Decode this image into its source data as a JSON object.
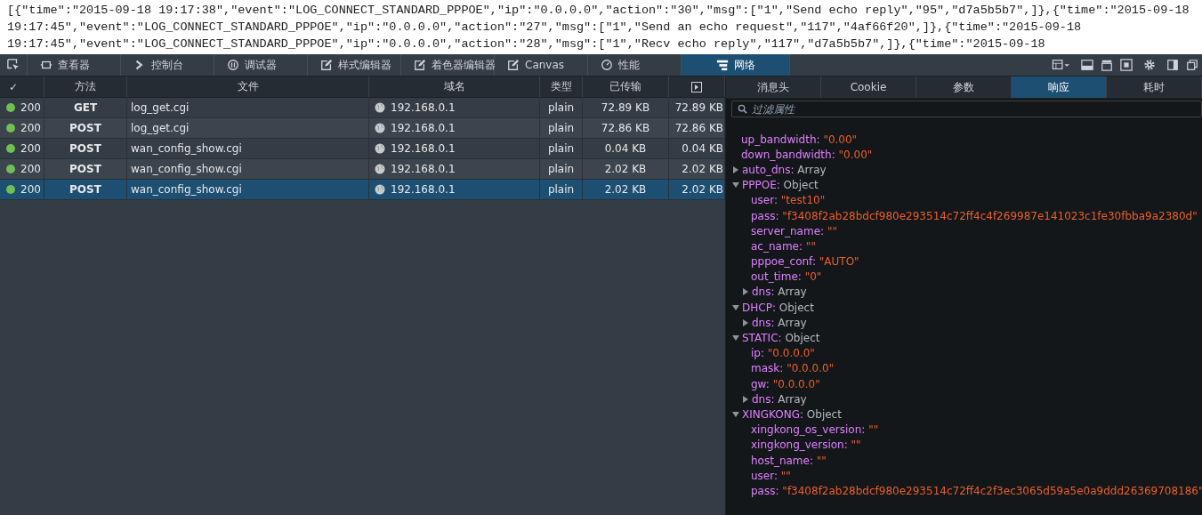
{
  "page_text": [
    "[{\"time\":\"2015-09-18 19:17:38\",\"event\":\"LOG_CONNECT_STANDARD_PPPOE\",\"ip\":\"0.0.0.0\",\"action\":\"30\",\"msg\":[\"1\",\"Send echo reply\",\"95\",\"d7a5b5b7\",]},{\"time\":\"2015-09-18",
    "19:17:45\",\"event\":\"LOG_CONNECT_STANDARD_PPPOE\",\"ip\":\"0.0.0.0\",\"action\":\"27\",\"msg\":[\"1\",\"Send an echo request\",\"117\",\"4af66f20\",]},{\"time\":\"2015-09-18",
    "19:17:45\",\"event\":\"LOG_CONNECT_STANDARD_PPPOE\",\"ip\":\"0.0.0.0\",\"action\":\"28\",\"msg\":[\"1\",\"Recv echo reply\",\"117\",\"d7a5b5b7\",]},{\"time\":\"2015-09-18"
  ],
  "toolbar": {
    "tabs": [
      {
        "label": "查看器",
        "selected": false
      },
      {
        "label": "控制台",
        "selected": false
      },
      {
        "label": "调试器",
        "selected": false
      },
      {
        "label": "样式编辑器",
        "selected": false
      },
      {
        "label": "着色器编辑器",
        "selected": false
      },
      {
        "label": "Canvas",
        "selected": false
      },
      {
        "label": "性能",
        "selected": false
      },
      {
        "label": "网络",
        "selected": true
      }
    ]
  },
  "table": {
    "columns": [
      "✓",
      "方法",
      "文件",
      "域名",
      "类型",
      "已传输"
    ],
    "rows": [
      {
        "status": "200",
        "method": "GET",
        "file": "log_get.cgi",
        "domain": "192.168.0.1",
        "type": "plain",
        "transferred": "72.89 KB",
        "size": "72.89 KB",
        "selected": false
      },
      {
        "status": "200",
        "method": "POST",
        "file": "log_get.cgi",
        "domain": "192.168.0.1",
        "type": "plain",
        "transferred": "72.86 KB",
        "size": "72.86 KB",
        "selected": false
      },
      {
        "status": "200",
        "method": "POST",
        "file": "wan_config_show.cgi",
        "domain": "192.168.0.1",
        "type": "plain",
        "transferred": "0.04 KB",
        "size": "0.04 KB",
        "selected": false
      },
      {
        "status": "200",
        "method": "POST",
        "file": "wan_config_show.cgi",
        "domain": "192.168.0.1",
        "type": "plain",
        "transferred": "2.02 KB",
        "size": "2.02 KB",
        "selected": false
      },
      {
        "status": "200",
        "method": "POST",
        "file": "wan_config_show.cgi",
        "domain": "192.168.0.1",
        "type": "plain",
        "transferred": "2.02 KB",
        "size": "2.02 KB",
        "selected": true
      }
    ]
  },
  "details": {
    "tabs": [
      {
        "label": "消息头",
        "selected": false
      },
      {
        "label": "Cookie",
        "selected": false
      },
      {
        "label": "参数",
        "selected": false
      },
      {
        "label": "响应",
        "selected": true
      },
      {
        "label": "耗时",
        "selected": false
      }
    ],
    "filter": {
      "placeholder": "过滤属性"
    },
    "tree": [
      {
        "key": "up_bandwidth:",
        "value": "\"0.00\"",
        "kind": "string"
      },
      {
        "key": "down_bandwidth:",
        "value": "\"0.00\"",
        "kind": "string"
      },
      {
        "key": "auto_dns:",
        "value": "Array",
        "kind": "type",
        "expanded": false
      },
      {
        "key": "PPPOE:",
        "value": "Object",
        "kind": "type",
        "expanded": true,
        "children": [
          {
            "key": "user:",
            "value": "\"test10\"",
            "kind": "string"
          },
          {
            "key": "pass:",
            "value": "\"f3408f2ab28bdcf980e293514c72ff4c4f269987e141023c1fe30fbba9a2380d\"",
            "kind": "string"
          },
          {
            "key": "server_name:",
            "value": "\"\"",
            "kind": "string"
          },
          {
            "key": "ac_name:",
            "value": "\"\"",
            "kind": "string"
          },
          {
            "key": "pppoe_conf:",
            "value": "\"AUTO\"",
            "kind": "string"
          },
          {
            "key": "out_time:",
            "value": "\"0\"",
            "kind": "string"
          },
          {
            "key": "dns:",
            "value": "Array",
            "kind": "type",
            "expanded": false
          }
        ]
      },
      {
        "key": "DHCP:",
        "value": "Object",
        "kind": "type",
        "expanded": true,
        "children": [
          {
            "key": "dns:",
            "value": "Array",
            "kind": "type",
            "expanded": false
          }
        ]
      },
      {
        "key": "STATIC:",
        "value": "Object",
        "kind": "type",
        "expanded": true,
        "children": [
          {
            "key": "ip:",
            "value": "\"0.0.0.0\"",
            "kind": "string"
          },
          {
            "key": "mask:",
            "value": "\"0.0.0.0\"",
            "kind": "string"
          },
          {
            "key": "gw:",
            "value": "\"0.0.0.0\"",
            "kind": "string"
          },
          {
            "key": "dns:",
            "value": "Array",
            "kind": "type",
            "expanded": false
          }
        ]
      },
      {
        "key": "XINGKONG:",
        "value": "Object",
        "kind": "type",
        "expanded": true,
        "children": [
          {
            "key": "xingkong_os_version:",
            "value": "\"\"",
            "kind": "string"
          },
          {
            "key": "xingkong_version:",
            "value": "\"\"",
            "kind": "string"
          },
          {
            "key": "host_name:",
            "value": "\"\"",
            "kind": "string"
          },
          {
            "key": "user:",
            "value": "\"\"",
            "kind": "string"
          },
          {
            "key": "pass:",
            "value": "\"f3408f2ab28bdcf980e293514c72ff4c2f3ec3065d59a5e0a9ddd26369708186\"",
            "kind": "string"
          }
        ]
      }
    ]
  }
}
